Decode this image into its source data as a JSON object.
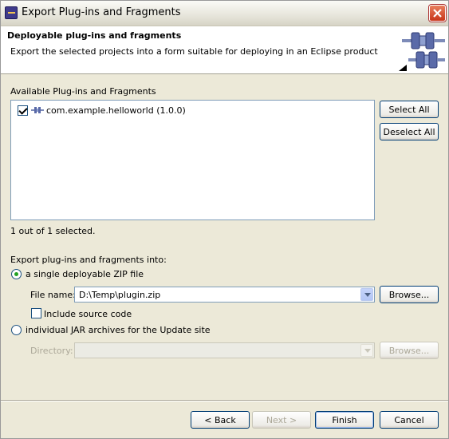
{
  "window": {
    "title": "Export Plug-ins and Fragments",
    "close_icon": "close-icon"
  },
  "banner": {
    "title": "Deployable plug-ins and fragments",
    "message": "Export the selected projects into a form suitable for deploying in an Eclipse product",
    "graphic_icon": "plugin-export-wizard-icon"
  },
  "plugins": {
    "label": "Available Plug-ins and Fragments",
    "items": [
      {
        "name": "com.example.helloworld (1.0.0)",
        "checked": true,
        "icon": "plugin-icon"
      }
    ],
    "select_all": "Select All",
    "deselect_all": "Deselect All",
    "selection_status": "1 out of 1 selected."
  },
  "export": {
    "label": "Export plug-ins and fragments into:",
    "zip_option": {
      "label": "a single deployable ZIP file",
      "selected": true,
      "file_name_label": "File name:",
      "file_name_value": "D:\\Temp\\plugin.zip",
      "browse": "Browse...",
      "include_source_label": "Include source code",
      "include_source_checked": false
    },
    "jar_option": {
      "label": "individual JAR archives for the Update site",
      "selected": false,
      "directory_label": "Directory:",
      "directory_value": "",
      "browse": "Browse..."
    }
  },
  "footer": {
    "back": "< Back",
    "next": "Next >",
    "finish": "Finish",
    "cancel": "Cancel"
  },
  "colors": {
    "dialog_bg": "#ece9d8",
    "banner_bg": "#ffffff",
    "button_border": "#003c74",
    "disabled_text": "#aca899"
  }
}
